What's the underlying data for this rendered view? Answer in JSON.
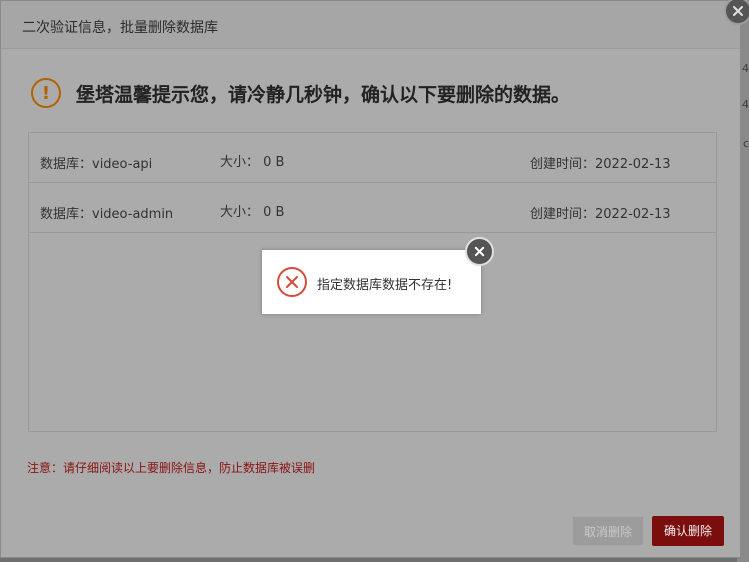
{
  "dialog": {
    "title": "二次验证信息，批量删除数据库",
    "warning": "堡塔温馨提示您，请冷静几秒钟，确认以下要删除的数据。",
    "databases": [
      {
        "name": "数据库：video-api",
        "size": "大小： 0 B",
        "created": "创建时间：2022-02-13"
      },
      {
        "name": "数据库：video-admin",
        "size": "大小： 0 B",
        "created": "创建时间：2022-02-13"
      }
    ],
    "note": "注意：请仔细阅读以上要删除信息，防止数据库被误删",
    "cancel_label": "取消删除",
    "confirm_label": "确认删除"
  },
  "toast": {
    "message": "指定数据库数据不存在!"
  },
  "background": {
    "edge_chars": [
      "4",
      "4",
      "c"
    ]
  },
  "icons": {
    "warning": "exclamation-circle-icon",
    "error": "x-circle-icon",
    "close": "close-icon"
  },
  "colors": {
    "warning": "#b36200",
    "error": "#d84a3a",
    "danger_button": "#7c0d0d",
    "note_text": "#8a1212"
  }
}
